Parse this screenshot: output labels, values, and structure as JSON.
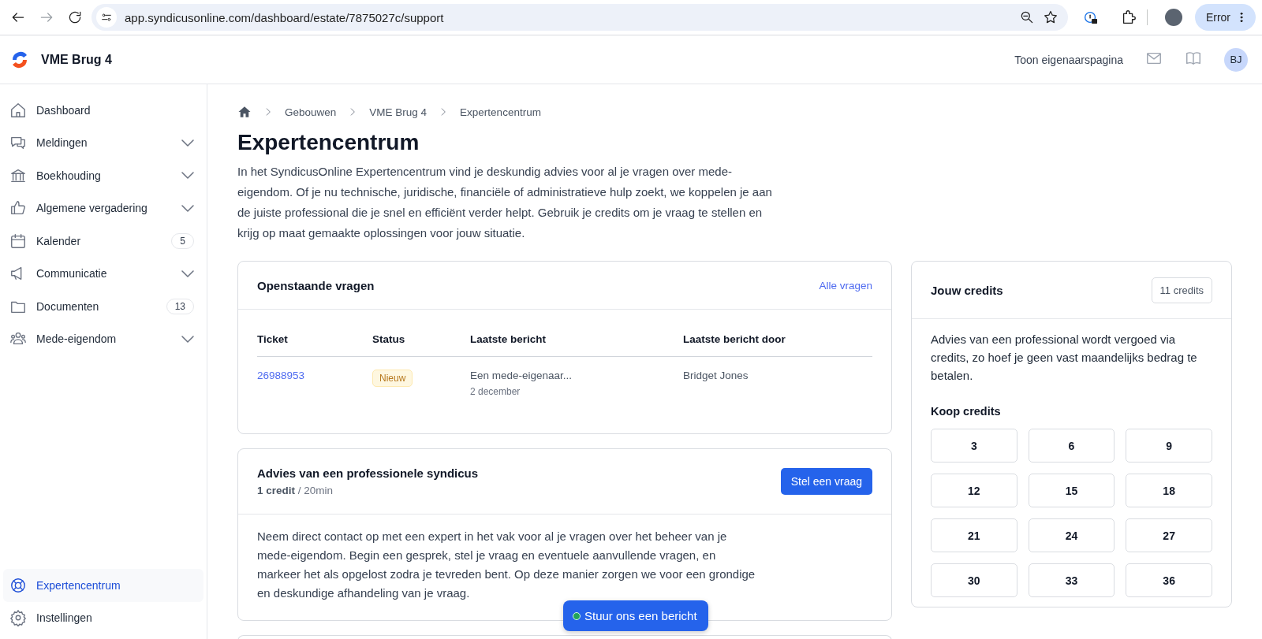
{
  "browser": {
    "url": "app.syndicusonline.com/dashboard/estate/7875027c/support",
    "profile_button": "Error"
  },
  "header": {
    "title": "VME Brug 4",
    "owner_link": "Toon eigenaarspagina",
    "avatar": "BJ"
  },
  "sidebar": {
    "items": [
      {
        "label": "Dashboard",
        "expandable": false,
        "selected": false
      },
      {
        "label": "Meldingen",
        "expandable": true,
        "selected": false
      },
      {
        "label": "Boekhouding",
        "expandable": true,
        "selected": false
      },
      {
        "label": "Algemene vergadering",
        "expandable": true,
        "selected": false
      },
      {
        "label": "Kalender",
        "expandable": false,
        "count": "5",
        "selected": false
      },
      {
        "label": "Communicatie",
        "expandable": true,
        "selected": false
      },
      {
        "label": "Documenten",
        "expandable": false,
        "count": "13",
        "selected": false
      },
      {
        "label": "Mede-eigendom",
        "expandable": true,
        "selected": false
      }
    ],
    "bottom_items": [
      {
        "label": "Expertencentrum",
        "selected": true
      },
      {
        "label": "Instellingen",
        "selected": false
      }
    ]
  },
  "breadcrumb": [
    "Gebouwen",
    "VME Brug 4",
    "Expertencentrum"
  ],
  "page": {
    "title": "Expertencentrum",
    "intro": "In het SyndicusOnline Expertencentrum vind je deskundig advies voor al je vragen over mede-eigendom. Of je nu technische, juridische, financiële of administratieve hulp zoekt, we koppelen je aan de juiste professional die je snel en efficiënt verder helpt. Gebruik je credits om je vraag te stellen en krijg op maat gemaakte oplossingen voor jouw situatie."
  },
  "open_questions": {
    "title": "Openstaande vragen",
    "link": "Alle vragen",
    "columns": [
      "Ticket",
      "Status",
      "Laatste bericht",
      "Laatste bericht door"
    ],
    "rows": [
      {
        "ticket": "26988953",
        "status": "Nieuw",
        "message": "Een mede-eigenaar...",
        "date": "2 december",
        "by": "Bridget Jones"
      }
    ]
  },
  "advice": {
    "title": "Advies van een professionele syndicus",
    "meta": "**1 credit** / 20min",
    "button": "Stel een vraag",
    "text": "Neem direct contact op met een expert in het vak voor al je vragen over het beheer van je mede-eigendom. Begin een gesprek, stel je vraag en eventuele aanvullende vragen, en markeer het als opgelost zodra je tevreden bent. Op deze manier zorgen we voor een grondige en deskundige afhandeling van je vraag."
  },
  "credits": {
    "title": "Jouw credits",
    "balance": "11 credits",
    "text": "Advies van een professional wordt vergoed via credits, zo hoef je geen vast maandelijks bedrag te betalen.",
    "buy_title": "Koop credits",
    "options": [
      "3",
      "6",
      "9",
      "12",
      "15",
      "18",
      "21",
      "24",
      "27",
      "30",
      "33",
      "36"
    ]
  },
  "chat_button": "Stuur ons een bericht"
}
